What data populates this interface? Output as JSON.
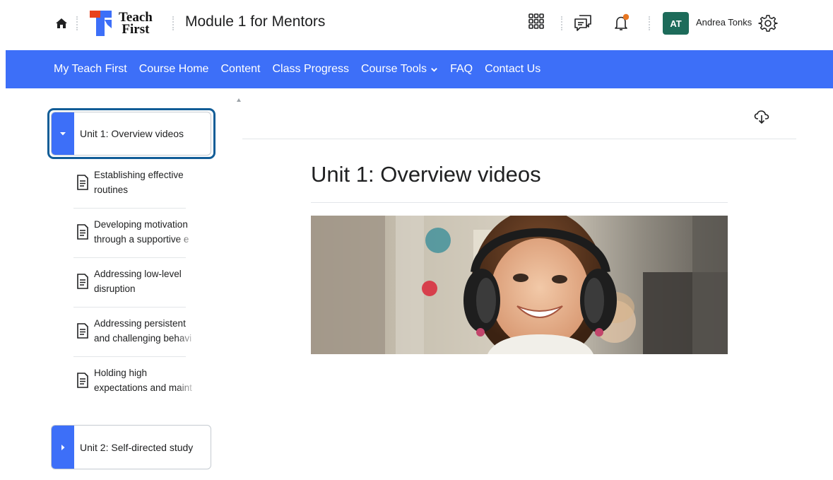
{
  "header": {
    "home_icon": "home-icon",
    "logo_text_line1": "Teach",
    "logo_text_line2": "First",
    "course_title": "Module 1 for Mentors",
    "waffle_icon": "app-grid-icon",
    "messages_icon": "chat-bubbles-icon",
    "notifications_icon": "bell-icon",
    "notification_dot_color": "#e87722",
    "avatar_initials": "AT",
    "avatar_color": "#1d6b5a",
    "user_name": "Andrea Tonks",
    "settings_icon": "gear-icon"
  },
  "nav": {
    "accent": "#3d6ff8",
    "items": [
      {
        "label": "My Teach First"
      },
      {
        "label": "Course Home"
      },
      {
        "label": "Content"
      },
      {
        "label": "Class Progress"
      },
      {
        "label": "Course Tools",
        "has_dropdown": true
      },
      {
        "label": "FAQ"
      },
      {
        "label": "Contact Us"
      }
    ]
  },
  "sidebar": {
    "units": [
      {
        "label": "Unit 1: Overview videos",
        "expanded": true
      },
      {
        "label": "Unit 2: Self-directed study",
        "expanded": false
      }
    ],
    "topics": [
      {
        "line1": "Establishing effective",
        "line2": "routines"
      },
      {
        "line1": "Developing motivation",
        "line2": "through a supportive e"
      },
      {
        "line1": "Addressing low-level",
        "line2": "disruption"
      },
      {
        "line1": "Addressing persistent",
        "line2": "and challenging behavi"
      },
      {
        "line1": "Holding high",
        "line2": "expectations and maint"
      }
    ]
  },
  "main": {
    "download_icon": "cloud-download-icon",
    "title": "Unit 1: Overview videos",
    "banner_image": "child-with-headphones-photo"
  }
}
